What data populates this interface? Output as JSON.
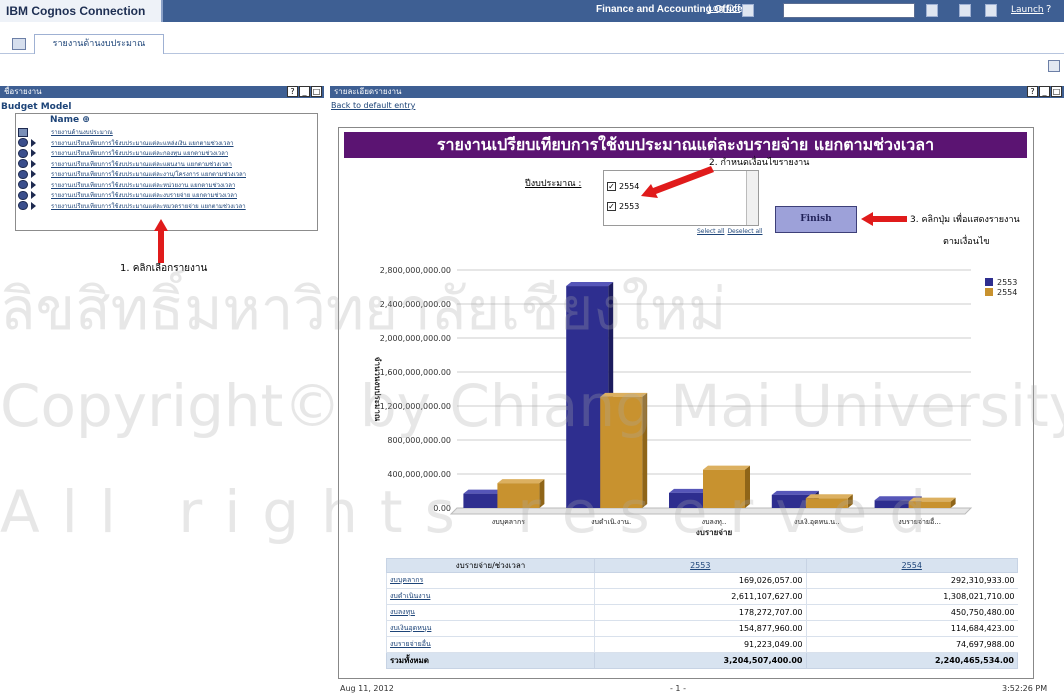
{
  "topbar": {
    "app_title": "IBM Cognos Connection",
    "user_label": "Finance and Accounting Officer",
    "logoff": "Log Off",
    "launch": "Launch",
    "help": "?"
  },
  "tabs": [
    {
      "label": "รายงานด้านงบประมาณ"
    }
  ],
  "left_panel": {
    "header": "ชื่อรายงาน",
    "section_title": "Budget Model",
    "column_header": "Name",
    "items": [
      {
        "label": "รายงานด้านงบประมาณ"
      },
      {
        "label": "รายงานเปรียบเทียบการใช้งบประมาณแต่ละแหล่งเงิน แยกตามช่วงเวลา"
      },
      {
        "label": "รายงานเปรียบเทียบการใช้งบประมาณแต่ละกองทุน แยกตามช่วงเวลา"
      },
      {
        "label": "รายงานเปรียบเทียบการใช้งบประมาณแต่ละแผนงาน แยกตามช่วงเวลา"
      },
      {
        "label": "รายงานเปรียบเทียบการใช้งบประมาณแต่ละงาน/โครงการ แยกตามช่วงเวลา"
      },
      {
        "label": "รายงานเปรียบเทียบการใช้งบประมาณแต่ละหน่วยงาน แยกตามช่วงเวลา"
      },
      {
        "label": "รายงานเปรียบเทียบการใช้งบประมาณแต่ละงบรายจ่าย แยกตามช่วงเวลา"
      },
      {
        "label": "รายงานเปรียบเทียบการใช้งบประมาณแต่ละหมวดรายจ่าย แยกตามช่วงเวลา"
      }
    ],
    "annotation": "1. คลิกเลือกรายงาน"
  },
  "right_panel": {
    "header": "รายละเอียดรายงาน",
    "back_link": "Back to default entry",
    "report_title": "รายงานเปรียบเทียบการใช้งบประมาณแต่ละงบรายจ่าย แยกตามช่วงเวลา",
    "prompt_label": "ปีงบประมาณ :",
    "year_options": [
      {
        "label": "2554",
        "checked": true
      },
      {
        "label": "2553",
        "checked": true
      }
    ],
    "select_all": "Select all",
    "deselect_all": "Deselect all",
    "finish_label": "Finish",
    "annotation_2": "2. กำหนดเงื่อนไขรายงาน",
    "annotation_3_line1": "3. คลิกปุ่ม เพื่อแสดงรายงาน",
    "annotation_3_line2": "ตามเงื่อนไข"
  },
  "chart_data": {
    "type": "bar",
    "categories": [
      "งบบุคลากร",
      "งบดำเนินงาน",
      "งบลงทุน",
      "งบเงินอุดหนุน",
      "งบรายจ่ายอื่น"
    ],
    "tick_labels": [
      "งบบุคลากร",
      "งบดำเนิ.งาน.",
      "งบลงทุ..",
      "งบเงิ.อุดหน.น..",
      "งบรายจ่ายอื่..."
    ],
    "series": [
      {
        "name": "2553",
        "values": [
          169026057,
          2611107627,
          178272707,
          154877960,
          91223049
        ],
        "color": "#2e2e8f"
      },
      {
        "name": "2554",
        "values": [
          292310933,
          1308021710,
          450750480,
          114684423,
          74697988
        ],
        "color": "#c8922f"
      }
    ],
    "y_ticks": [
      "0.00",
      "400,000,000.00",
      "800,000,000.00",
      "1,200,000,000.00",
      "1,600,000,000.00",
      "2,000,000,000.00",
      "2,400,000,000.00",
      "2,800,000,000.00"
    ],
    "ylim": [
      0,
      2800000000
    ],
    "xlabel": "งบรายจ่าย",
    "ylabel": "จำนวนงบประมาณ",
    "legend": "top-right",
    "grid": true
  },
  "table": {
    "headers": [
      "งบรายจ่าย/ช่วงเวลา",
      "2553",
      "2554"
    ],
    "rows": [
      {
        "label": "งบบุคลากร",
        "v2553": "169,026,057.00",
        "v2554": "292,310,933.00"
      },
      {
        "label": "งบดำเนินงาน",
        "v2553": "2,611,107,627.00",
        "v2554": "1,308,021,710.00"
      },
      {
        "label": "งบลงทุน",
        "v2553": "178,272,707.00",
        "v2554": "450,750,480.00"
      },
      {
        "label": "งบเงินอุดหนุน",
        "v2553": "154,877,960.00",
        "v2554": "114,684,423.00"
      },
      {
        "label": "งบรายจ่ายอื่น",
        "v2553": "91,223,049.00",
        "v2554": "74,697,988.00"
      }
    ],
    "total": {
      "label": "รวมทั้งหมด",
      "v2553": "3,204,507,400.00",
      "v2554": "2,240,465,534.00"
    }
  },
  "footer": {
    "date": "Aug 11, 2012",
    "page": "- 1 -",
    "time": "3:52:26 PM"
  },
  "watermark": {
    "line1": "ลิขสิทธิ์มหาวิทยาลัยเชียงใหม่",
    "line2": "Copyright© by Chiang Mai University",
    "line3": "All rights reserved"
  }
}
